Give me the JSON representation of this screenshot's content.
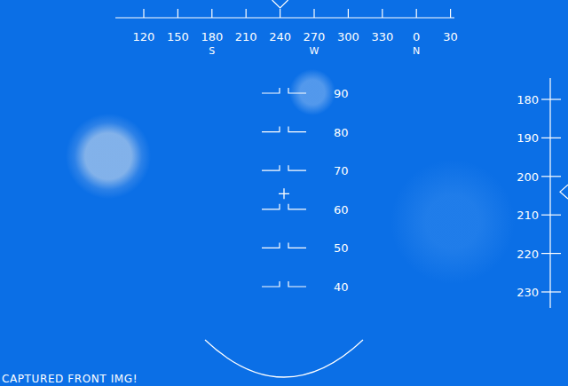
{
  "hud": {
    "compass": {
      "heading": 240,
      "ticks": [
        {
          "label": "120"
        },
        {
          "label": "150"
        },
        {
          "label": "180",
          "cardinal": "S"
        },
        {
          "label": "210"
        },
        {
          "label": "240"
        },
        {
          "label": "270",
          "cardinal": "W"
        },
        {
          "label": "300"
        },
        {
          "label": "330"
        },
        {
          "label": "0",
          "cardinal": "N"
        },
        {
          "label": "30"
        }
      ]
    },
    "pitch_ladder": {
      "pitch": 64,
      "rungs": [
        "90",
        "80",
        "70",
        "60",
        "50",
        "40"
      ]
    },
    "depth_tape": {
      "depth": 204,
      "marks": [
        "180",
        "190",
        "200",
        "210",
        "220",
        "230"
      ]
    },
    "status": "CAPTURED FRONT IMG!"
  }
}
